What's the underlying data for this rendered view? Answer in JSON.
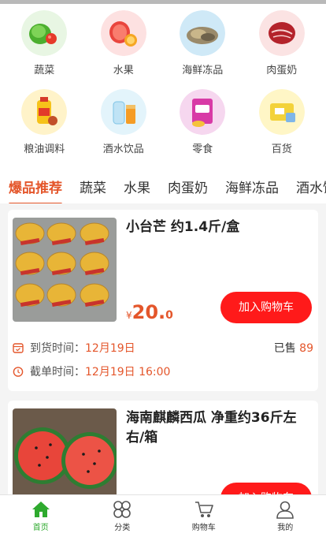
{
  "categories": [
    {
      "label": "蔬菜",
      "icon": "vegetable-icon"
    },
    {
      "label": "水果",
      "icon": "fruit-icon"
    },
    {
      "label": "海鲜冻品",
      "icon": "seafood-icon"
    },
    {
      "label": "肉蛋奶",
      "icon": "meat-icon"
    },
    {
      "label": "粮油调料",
      "icon": "oil-icon"
    },
    {
      "label": "酒水饮品",
      "icon": "drinks-icon"
    },
    {
      "label": "零食",
      "icon": "snack-icon"
    },
    {
      "label": "百货",
      "icon": "goods-icon"
    }
  ],
  "tabs": [
    "爆品推荐",
    "蔬菜",
    "水果",
    "肉蛋奶",
    "海鲜冻品",
    "酒水饮品"
  ],
  "products": [
    {
      "title": "小台芒 约1.4斤/盒",
      "currency": "¥",
      "price_int": "20.",
      "price_dec": "0",
      "add_label": "加入购物车",
      "arrival_label": "到货时间：",
      "arrival_value": "12月19日",
      "deadline_label": "截单时间：",
      "deadline_value": "12月19日 16:00",
      "sold_label": "已售",
      "sold_value": "89"
    },
    {
      "title": "海南麒麟西瓜 净重约36斤左右/箱",
      "add_label": "加入购物车"
    }
  ],
  "tabbar": [
    {
      "label": "首页",
      "icon": "home-icon",
      "active": true
    },
    {
      "label": "分类",
      "icon": "category-icon"
    },
    {
      "label": "购物车",
      "icon": "cart-icon"
    },
    {
      "label": "我的",
      "icon": "user-icon"
    }
  ],
  "colors": {
    "accent": "#e4562b",
    "button": "#ff1a1a",
    "active_tab": "#2eaa2e"
  }
}
